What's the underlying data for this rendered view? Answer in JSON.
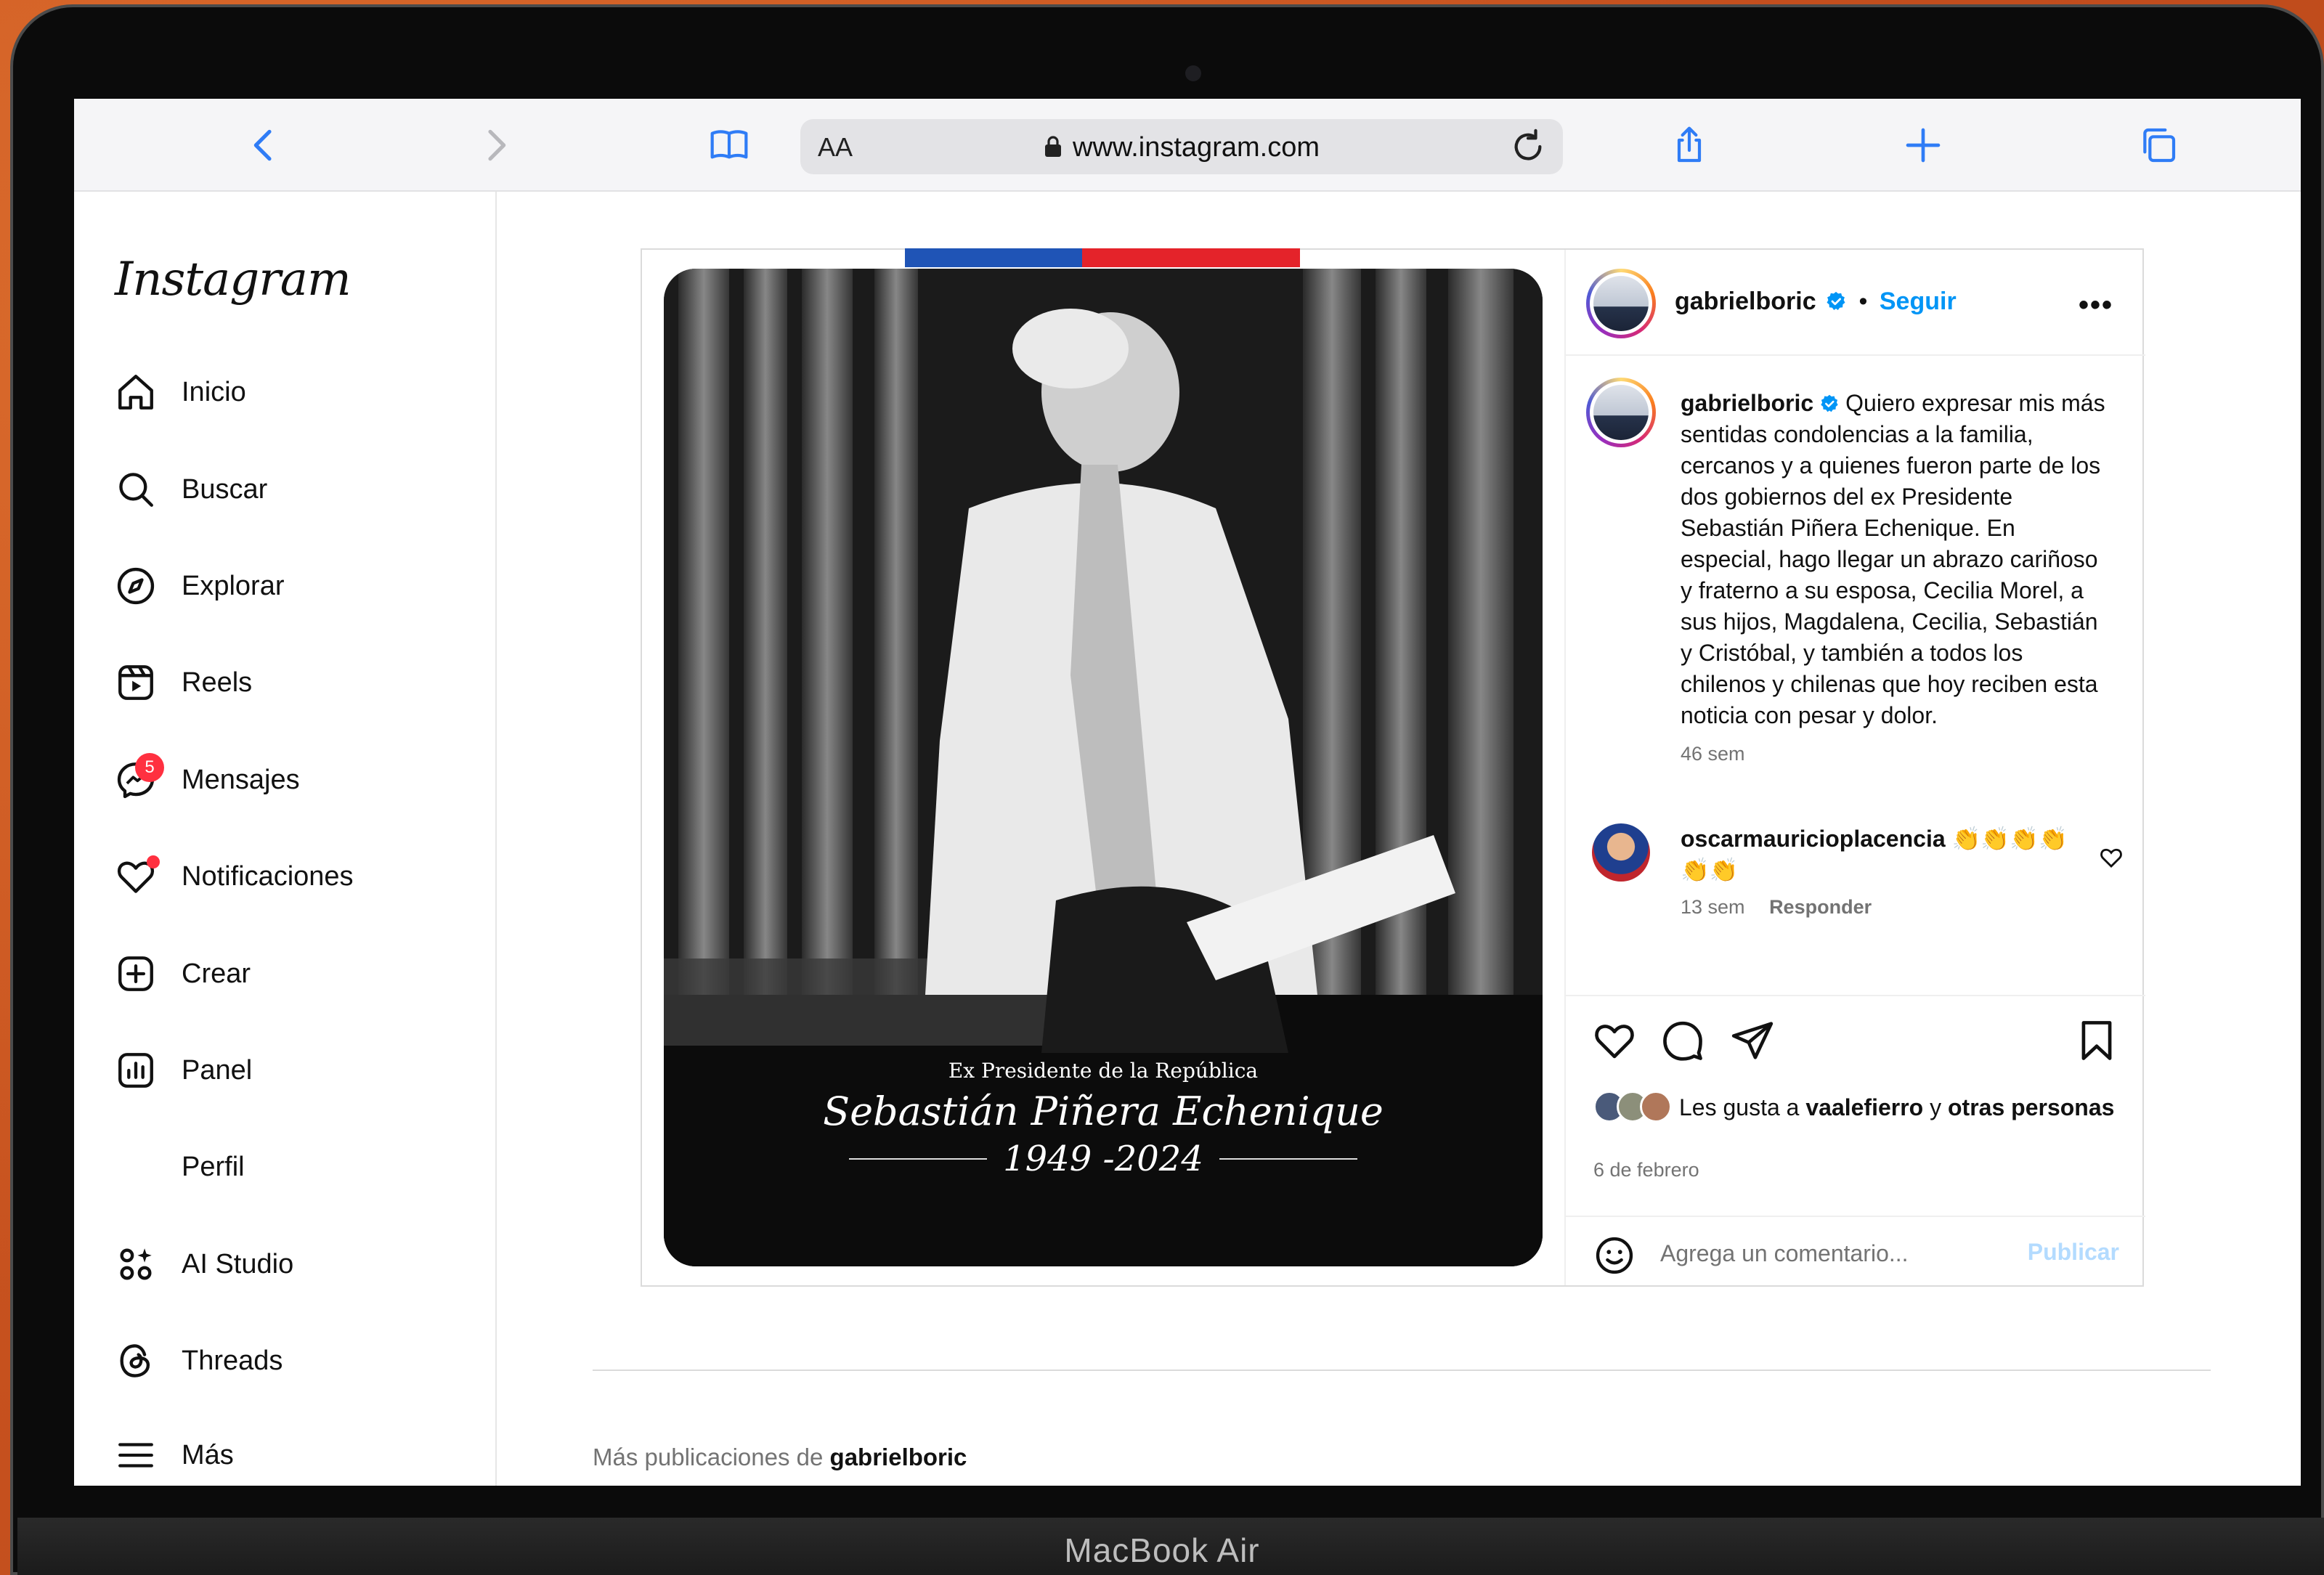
{
  "device": {
    "label": "MacBook Air"
  },
  "browser": {
    "url": "www.instagram.com",
    "reader_label": "AA",
    "icons": [
      "back-icon",
      "forward-icon",
      "bookmarks-icon",
      "lock-icon",
      "reload-icon",
      "share-icon",
      "new-tab-icon",
      "tabs-icon"
    ]
  },
  "sidebar": {
    "logo": "Instagram",
    "items": [
      {
        "label": "Inicio",
        "icon": "home-icon"
      },
      {
        "label": "Buscar",
        "icon": "search-icon"
      },
      {
        "label": "Explorar",
        "icon": "compass-icon"
      },
      {
        "label": "Reels",
        "icon": "reels-icon"
      },
      {
        "label": "Mensajes",
        "icon": "messenger-icon",
        "badge": "5"
      },
      {
        "label": "Notificaciones",
        "icon": "heart-icon"
      },
      {
        "label": "Crear",
        "icon": "plus-square-icon"
      },
      {
        "label": "Panel",
        "icon": "dashboard-icon"
      },
      {
        "label": "Perfil",
        "icon": ""
      },
      {
        "label": "AI Studio",
        "icon": "ai-studio-icon"
      },
      {
        "label": "Threads",
        "icon": "threads-icon"
      },
      {
        "label": "Más",
        "icon": "menu-icon"
      }
    ]
  },
  "post": {
    "image_overlay": {
      "subtitle": "Ex Presidente de la República",
      "name": "Sebastián Piñera Echenique",
      "years": "1949 -2024"
    },
    "header": {
      "username": "gabrielboric",
      "separator": "•",
      "follow": "Seguir",
      "more": "•••"
    },
    "caption": {
      "username": "gabrielboric",
      "text": "Quiero expresar mis más sentidas condolencias a la familia, cercanos y a quienes fueron parte de los dos gobiernos del ex Presidente Sebastián Piñera Echenique. En especial, hago llegar un abrazo cariñoso y fraterno a su esposa, Cecilia Morel, a sus hijos, Magdalena, Cecilia, Sebastián y Cristóbal, y también a todos los chilenos y chilenas que hoy reciben esta noticia con pesar y dolor.",
      "time": "46 sem"
    },
    "comment": {
      "username": "oscarmauricioplacencia",
      "text": "👏👏👏👏👏👏",
      "time": "13 sem",
      "reply": "Responder"
    },
    "likes": {
      "prefix": "Les gusta a",
      "user": "vaalefierro",
      "joiner": "y",
      "others": "otras personas"
    },
    "date": "6 de febrero",
    "add_comment": {
      "placeholder": "Agrega un comentario...",
      "publish": "Publicar"
    }
  },
  "more_posts": {
    "prefix": "Más publicaciones de",
    "user": "gabrielboric"
  },
  "colors": {
    "accent": "#0095f6",
    "badge": "#ff3040",
    "publish_disabled": "#b3dbff"
  }
}
